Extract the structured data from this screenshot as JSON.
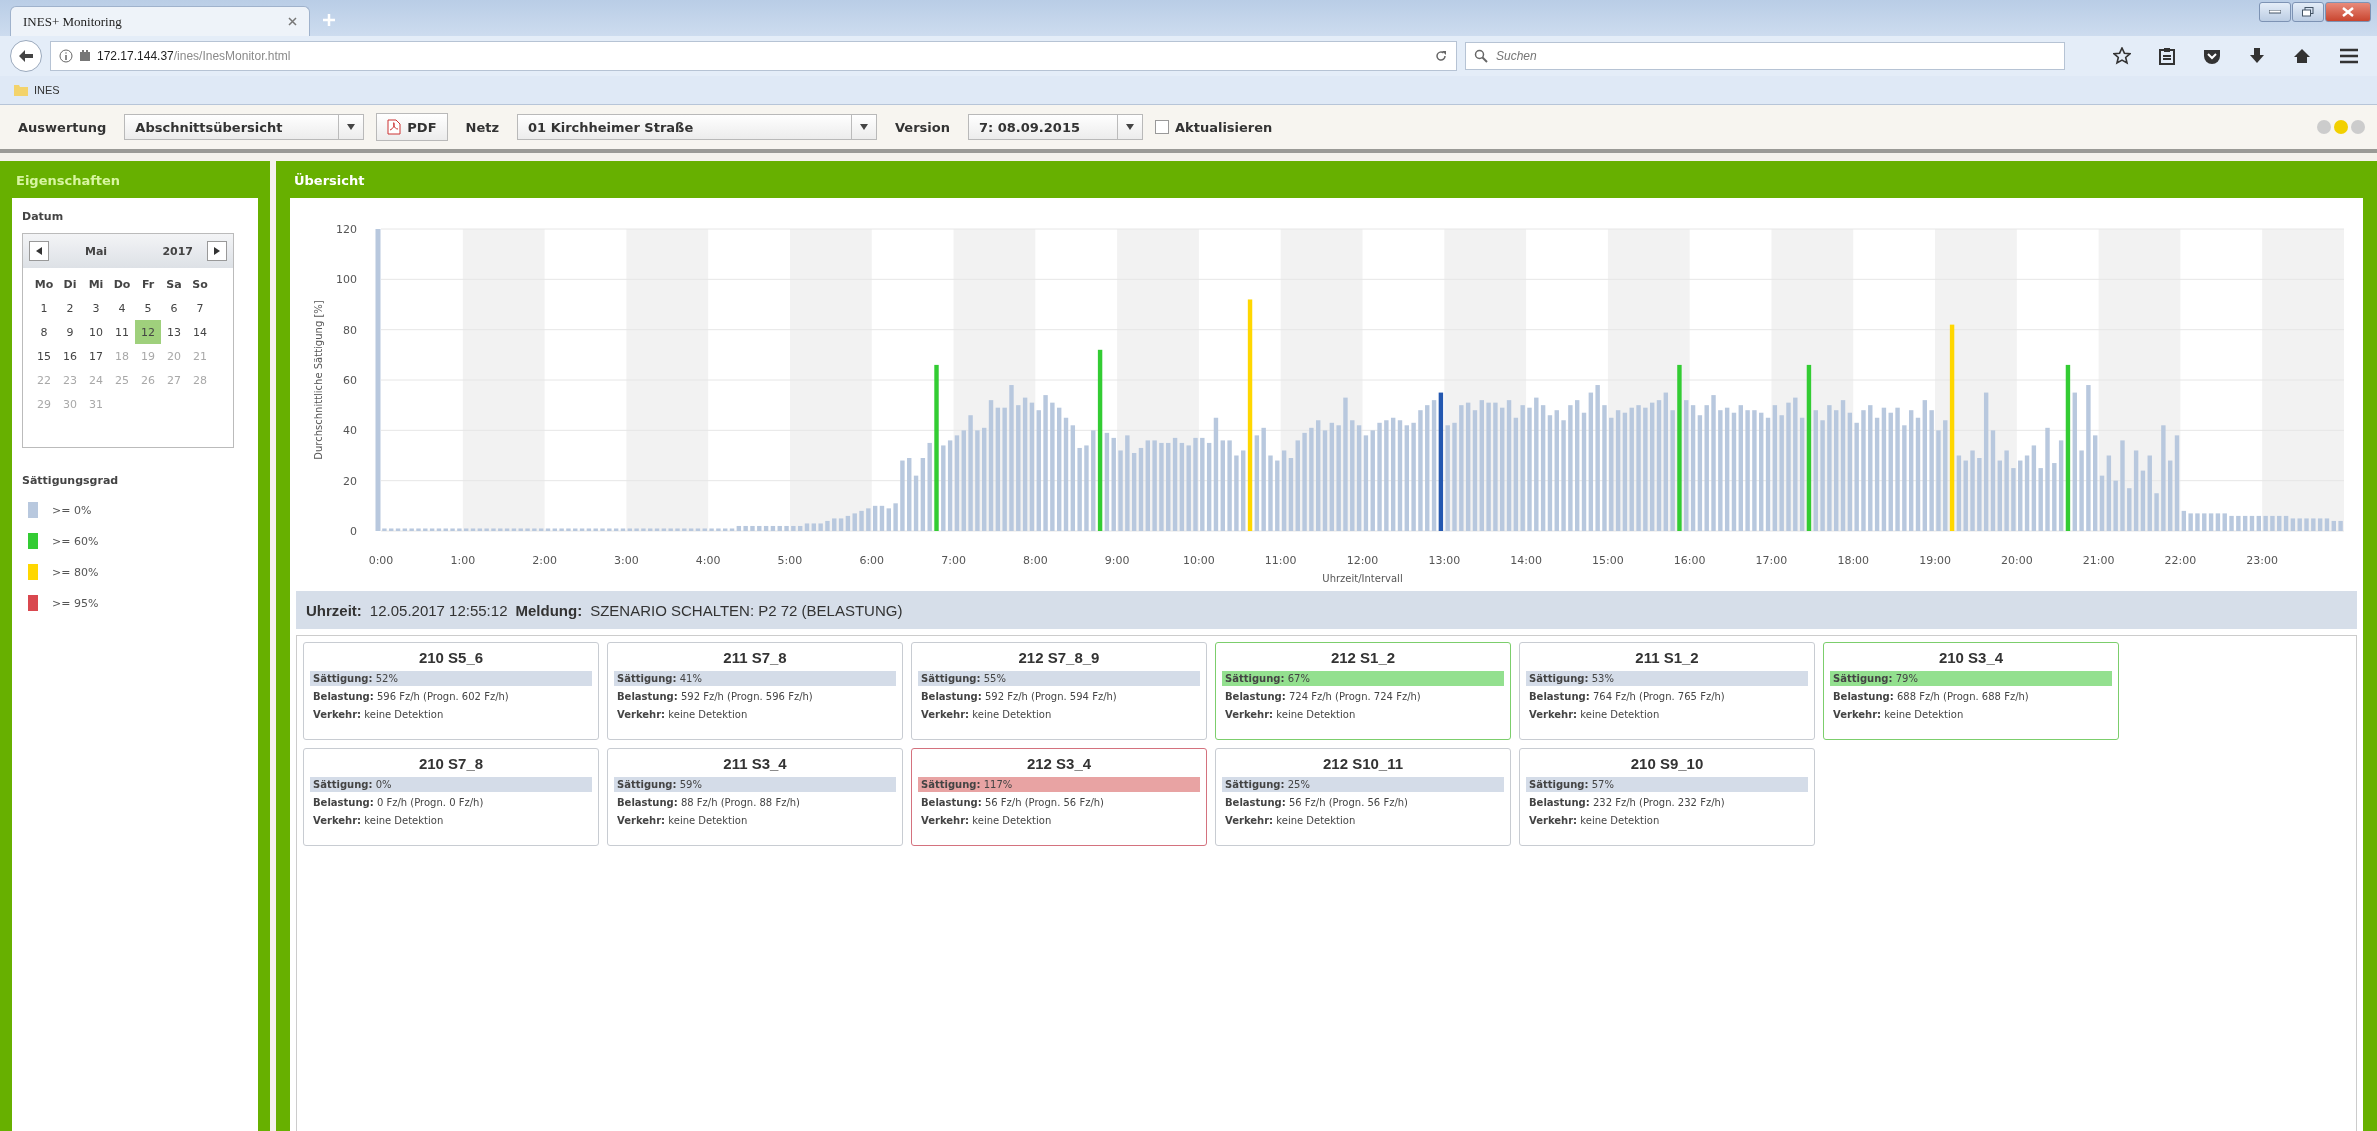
{
  "browser": {
    "tab_title": "INES+ Monitoring",
    "url_host": "172.17.144.37",
    "url_path": "/ines/InesMonitor.html",
    "search": {
      "placeholder": "Suchen"
    },
    "bookmarks": [
      "INES"
    ]
  },
  "toolbar": {
    "evaluation_label": "Auswertung",
    "evaluation_value": "Abschnittsübersicht",
    "pdf_button": "PDF",
    "network_label": "Netz",
    "network_value": "01 Kirchheimer Straße",
    "version_label": "Version",
    "version_value": "7: 08.09.2015",
    "refresh": {
      "label": "Aktualisieren",
      "checked": false
    },
    "status_lights": [
      {
        "color": "#cccccc"
      },
      {
        "color": "#f2d000"
      },
      {
        "color": "#cccccc"
      }
    ]
  },
  "sidebar": {
    "title": "Eigenschaften",
    "date_label": "Datum",
    "calendar": {
      "month": "Mai",
      "year": "2017",
      "weekdays": [
        "Mo",
        "Di",
        "Mi",
        "Do",
        "Fr",
        "Sa",
        "So"
      ],
      "days": [
        {
          "label": "1",
          "selected": false,
          "disabled": false
        },
        {
          "label": "2",
          "selected": false,
          "disabled": false
        },
        {
          "label": "3",
          "selected": false,
          "disabled": false
        },
        {
          "label": "4",
          "selected": false,
          "disabled": false
        },
        {
          "label": "5",
          "selected": false,
          "disabled": false
        },
        {
          "label": "6",
          "selected": false,
          "disabled": false
        },
        {
          "label": "7",
          "selected": false,
          "disabled": false
        },
        {
          "label": "8",
          "selected": false,
          "disabled": false
        },
        {
          "label": "9",
          "selected": false,
          "disabled": false
        },
        {
          "label": "10",
          "selected": false,
          "disabled": false
        },
        {
          "label": "11",
          "selected": false,
          "disabled": false
        },
        {
          "label": "12",
          "selected": true,
          "disabled": false
        },
        {
          "label": "13",
          "selected": false,
          "disabled": false
        },
        {
          "label": "14",
          "selected": false,
          "disabled": false
        },
        {
          "label": "15",
          "selected": false,
          "disabled": false
        },
        {
          "label": "16",
          "selected": false,
          "disabled": false
        },
        {
          "label": "17",
          "selected": false,
          "disabled": false
        },
        {
          "label": "18",
          "selected": false,
          "disabled": true
        },
        {
          "label": "19",
          "selected": false,
          "disabled": true
        },
        {
          "label": "20",
          "selected": false,
          "disabled": true
        },
        {
          "label": "21",
          "selected": false,
          "disabled": true
        },
        {
          "label": "22",
          "selected": false,
          "disabled": true
        },
        {
          "label": "23",
          "selected": false,
          "disabled": true
        },
        {
          "label": "24",
          "selected": false,
          "disabled": true
        },
        {
          "label": "25",
          "selected": false,
          "disabled": true
        },
        {
          "label": "26",
          "selected": false,
          "disabled": true
        },
        {
          "label": "27",
          "selected": false,
          "disabled": true
        },
        {
          "label": "28",
          "selected": false,
          "disabled": true
        },
        {
          "label": "29",
          "selected": false,
          "disabled": true
        },
        {
          "label": "30",
          "selected": false,
          "disabled": true
        },
        {
          "label": "31",
          "selected": false,
          "disabled": true
        }
      ]
    },
    "legend_title": "Sättigungsgrad",
    "legend": [
      {
        "label": ">= 0%",
        "color": "#b8c8de"
      },
      {
        "label": ">= 60%",
        "color": "#33cc33"
      },
      {
        "label": ">= 80%",
        "color": "#ffd700"
      },
      {
        "label": ">= 95%",
        "color": "#d9484f"
      }
    ]
  },
  "main": {
    "title": "Übersicht",
    "chart_data": {
      "type": "bar",
      "xlabel": "Uhrzeit/Intervall",
      "ylabel": "Durchschnittliche Sättigung [%]",
      "ylim": [
        0,
        120
      ],
      "grid": true,
      "xlim": [
        0,
        1440
      ],
      "x": [
        0,
        5,
        10,
        15,
        20,
        25,
        30,
        35,
        40,
        45,
        50,
        55,
        60,
        65,
        70,
        75,
        80,
        85,
        90,
        95,
        100,
        105,
        110,
        115,
        120,
        125,
        130,
        135,
        140,
        145,
        150,
        155,
        160,
        165,
        170,
        175,
        180,
        185,
        190,
        195,
        200,
        205,
        210,
        215,
        220,
        225,
        230,
        235,
        240,
        245,
        250,
        255,
        260,
        265,
        270,
        275,
        280,
        285,
        290,
        295,
        300,
        305,
        310,
        315,
        320,
        325,
        330,
        335,
        340,
        345,
        350,
        355,
        360,
        365,
        370,
        375,
        380,
        385,
        390,
        395,
        400,
        405,
        410,
        415,
        420,
        425,
        430,
        435,
        440,
        445,
        450,
        455,
        460,
        465,
        470,
        475,
        480,
        485,
        490,
        495,
        500,
        505,
        510,
        515,
        520,
        525,
        530,
        535,
        540,
        545,
        550,
        555,
        560,
        565,
        570,
        575,
        580,
        585,
        590,
        595,
        600,
        605,
        610,
        615,
        620,
        625,
        630,
        635,
        640,
        645,
        650,
        655,
        660,
        665,
        670,
        675,
        680,
        685,
        690,
        695,
        700,
        705,
        710,
        715,
        720,
        725,
        730,
        735,
        740,
        745,
        750,
        755,
        760,
        765,
        770,
        775,
        780,
        785,
        790,
        795,
        800,
        805,
        810,
        815,
        820,
        825,
        830,
        835,
        840,
        845,
        850,
        855,
        860,
        865,
        870,
        875,
        880,
        885,
        890,
        895,
        900,
        905,
        910,
        915,
        920,
        925,
        930,
        935,
        940,
        945,
        950,
        955,
        960,
        965,
        970,
        975,
        980,
        985,
        990,
        995,
        1000,
        1005,
        1010,
        1015,
        1020,
        1025,
        1030,
        1035,
        1040,
        1045,
        1050,
        1055,
        1060,
        1065,
        1070,
        1075,
        1080,
        1085,
        1090,
        1095,
        1100,
        1105,
        1110,
        1115,
        1120,
        1125,
        1130,
        1135,
        1140,
        1145,
        1150,
        1155,
        1160,
        1165,
        1170,
        1175,
        1180,
        1185,
        1190,
        1195,
        1200,
        1205,
        1210,
        1215,
        1220,
        1225,
        1230,
        1235,
        1240,
        1245,
        1250,
        1255,
        1260,
        1265,
        1270,
        1275,
        1280,
        1285,
        1290,
        1295,
        1300,
        1305,
        1310,
        1315,
        1320,
        1325,
        1330,
        1335,
        1340,
        1345,
        1350,
        1355,
        1360,
        1365,
        1370,
        1375,
        1380,
        1385,
        1390,
        1395,
        1400,
        1405,
        1410,
        1415,
        1420,
        1425,
        1430,
        1435
      ],
      "yticks": [
        0,
        20,
        40,
        60,
        80,
        100,
        120
      ],
      "xticks": [
        {
          "value": 0,
          "label": "0:00"
        },
        {
          "value": 60,
          "label": "1:00"
        },
        {
          "value": 120,
          "label": "2:00"
        },
        {
          "value": 180,
          "label": "3:00"
        },
        {
          "value": 240,
          "label": "4:00"
        },
        {
          "value": 300,
          "label": "5:00"
        },
        {
          "value": 360,
          "label": "6:00"
        },
        {
          "value": 420,
          "label": "7:00"
        },
        {
          "value": 480,
          "label": "8:00"
        },
        {
          "value": 540,
          "label": "9:00"
        },
        {
          "value": 600,
          "label": "10:00"
        },
        {
          "value": 660,
          "label": "11:00"
        },
        {
          "value": 720,
          "label": "12:00"
        },
        {
          "value": 780,
          "label": "13:00"
        },
        {
          "value": 840,
          "label": "14:00"
        },
        {
          "value": 900,
          "label": "15:00"
        },
        {
          "value": 960,
          "label": "16:00"
        },
        {
          "value": 1020,
          "label": "17:00"
        },
        {
          "value": 1080,
          "label": "18:00"
        },
        {
          "value": 1140,
          "label": "19:00"
        },
        {
          "value": 1200,
          "label": "20:00"
        },
        {
          "value": 1260,
          "label": "21:00"
        },
        {
          "value": 1320,
          "label": "22:00"
        },
        {
          "value": 1380,
          "label": "23:00"
        }
      ],
      "series": [
        {
          "color": "#b8c8de",
          "values": [
            1,
            1,
            1,
            1,
            1,
            1,
            1,
            1,
            1,
            1,
            1,
            1,
            1,
            1,
            1,
            1,
            1,
            1,
            1,
            1,
            1,
            1,
            1,
            1,
            1,
            1,
            1,
            1,
            1,
            1,
            1,
            1,
            1,
            1,
            1,
            1,
            1,
            1,
            1,
            1,
            1,
            1,
            1,
            1,
            1,
            1,
            1,
            1,
            1,
            1,
            1,
            1,
            2,
            2,
            2,
            2,
            2,
            2,
            2,
            2,
            2,
            2,
            3,
            3,
            3,
            4,
            5,
            5,
            6,
            7,
            8,
            9,
            10,
            10,
            9,
            11,
            28,
            29,
            22,
            29,
            35,
            null,
            34,
            36,
            38,
            40,
            46,
            40,
            41,
            52,
            49,
            49,
            58,
            50,
            53,
            51,
            48,
            54,
            51,
            49,
            45,
            42,
            33,
            34,
            40,
            null,
            39,
            37,
            32,
            38,
            31,
            33,
            36,
            36,
            35,
            35,
            37,
            35,
            34,
            37,
            37,
            35,
            45,
            36,
            36,
            30,
            32,
            null,
            38,
            41,
            30,
            28,
            32,
            29,
            36,
            39,
            41,
            44,
            40,
            43,
            42,
            53,
            44,
            42,
            38,
            40,
            43,
            44,
            45,
            44,
            42,
            43,
            48,
            50,
            52,
            null,
            42,
            43,
            50,
            51,
            48,
            52,
            51,
            51,
            49,
            52,
            45,
            50,
            49,
            53,
            50,
            46,
            48,
            44,
            50,
            52,
            47,
            55,
            58,
            50,
            45,
            48,
            47,
            49,
            50,
            49,
            51,
            52,
            55,
            48,
            null,
            52,
            50,
            46,
            50,
            54,
            48,
            49,
            47,
            50,
            48,
            48,
            47,
            45,
            50,
            46,
            51,
            53,
            45,
            null,
            48,
            44,
            50,
            48,
            52,
            47,
            43,
            48,
            50,
            45,
            49,
            47,
            49,
            42,
            48,
            45,
            52,
            48,
            40,
            44,
            null,
            30,
            28,
            32,
            29,
            55,
            40,
            28,
            32,
            25,
            28,
            30,
            34,
            25,
            41,
            27,
            36,
            null,
            55,
            32,
            58,
            38,
            22,
            30,
            20,
            36,
            17,
            32,
            24,
            30,
            15,
            42,
            28,
            38,
            8,
            7,
            7,
            7,
            7,
            7,
            7,
            6,
            6,
            6,
            6,
            6,
            6,
            6,
            6,
            6,
            5,
            5,
            5,
            5,
            5,
            5,
            4,
            4
          ]
        },
        {
          "color": "#33cc33",
          "values": [
            null,
            null,
            null,
            null,
            null,
            null,
            null,
            null,
            null,
            null,
            null,
            null,
            null,
            null,
            null,
            null,
            null,
            null,
            null,
            null,
            null,
            null,
            null,
            null,
            null,
            null,
            null,
            null,
            null,
            null,
            null,
            null,
            null,
            null,
            null,
            null,
            null,
            null,
            null,
            null,
            null,
            null,
            null,
            null,
            null,
            null,
            null,
            null,
            null,
            null,
            null,
            null,
            null,
            null,
            null,
            null,
            null,
            null,
            null,
            null,
            null,
            null,
            null,
            null,
            null,
            null,
            null,
            null,
            null,
            null,
            null,
            null,
            null,
            null,
            null,
            null,
            null,
            null,
            null,
            null,
            null,
            66,
            null,
            null,
            null,
            null,
            null,
            null,
            null,
            null,
            null,
            null,
            null,
            null,
            null,
            null,
            null,
            null,
            null,
            null,
            null,
            null,
            null,
            null,
            null,
            72,
            null,
            null,
            null,
            null,
            null,
            null,
            null,
            null,
            null,
            null,
            null,
            null,
            null,
            null,
            null,
            null,
            null,
            null,
            null,
            null,
            null,
            null,
            null,
            null,
            null,
            null,
            null,
            null,
            null,
            null,
            null,
            null,
            null,
            null,
            null,
            null,
            null,
            null,
            null,
            null,
            null,
            null,
            null,
            null,
            null,
            null,
            null,
            null,
            null,
            null,
            null,
            null,
            null,
            null,
            null,
            null,
            null,
            null,
            null,
            null,
            null,
            null,
            null,
            null,
            null,
            null,
            null,
            null,
            null,
            null,
            null,
            null,
            null,
            null,
            null,
            null,
            null,
            null,
            null,
            null,
            null,
            null,
            null,
            null,
            66,
            null,
            null,
            null,
            null,
            null,
            null,
            null,
            null,
            null,
            null,
            null,
            null,
            null,
            null,
            null,
            null,
            null,
            null,
            66,
            null,
            null,
            null,
            null,
            null,
            null,
            null,
            null,
            null,
            null,
            null,
            null,
            null,
            null,
            null,
            null,
            null,
            null,
            null,
            null,
            null,
            null,
            null,
            null,
            null,
            null,
            null,
            null,
            null,
            null,
            null,
            null,
            null,
            null,
            null,
            null,
            null,
            66,
            null,
            null,
            null,
            null,
            null,
            null,
            null,
            null,
            null,
            null,
            null,
            null,
            null,
            null,
            null,
            null,
            null,
            null,
            null,
            null,
            null,
            null,
            null,
            null,
            null,
            null,
            null,
            null,
            null,
            null,
            null,
            null,
            null,
            null,
            null,
            null,
            null,
            null,
            null,
            null
          ]
        },
        {
          "color": "#ffd700",
          "values": [
            null,
            null,
            null,
            null,
            null,
            null,
            null,
            null,
            null,
            null,
            null,
            null,
            null,
            null,
            null,
            null,
            null,
            null,
            null,
            null,
            null,
            null,
            null,
            null,
            null,
            null,
            null,
            null,
            null,
            null,
            null,
            null,
            null,
            null,
            null,
            null,
            null,
            null,
            null,
            null,
            null,
            null,
            null,
            null,
            null,
            null,
            null,
            null,
            null,
            null,
            null,
            null,
            null,
            null,
            null,
            null,
            null,
            null,
            null,
            null,
            null,
            null,
            null,
            null,
            null,
            null,
            null,
            null,
            null,
            null,
            null,
            null,
            null,
            null,
            null,
            null,
            null,
            null,
            null,
            null,
            null,
            null,
            null,
            null,
            null,
            null,
            null,
            null,
            null,
            null,
            null,
            null,
            null,
            null,
            null,
            null,
            null,
            null,
            null,
            null,
            null,
            null,
            null,
            null,
            null,
            null,
            null,
            null,
            null,
            null,
            null,
            null,
            null,
            null,
            null,
            null,
            null,
            null,
            null,
            null,
            null,
            null,
            null,
            null,
            null,
            null,
            null,
            92,
            null,
            null,
            null,
            null,
            null,
            null,
            null,
            null,
            null,
            null,
            null,
            null,
            null,
            null,
            null,
            null,
            null,
            null,
            null,
            null,
            null,
            null,
            null,
            null,
            null,
            null,
            null,
            null,
            null,
            null,
            null,
            null,
            null,
            null,
            null,
            null,
            null,
            null,
            null,
            null,
            null,
            null,
            null,
            null,
            null,
            null,
            null,
            null,
            null,
            null,
            null,
            null,
            null,
            null,
            null,
            null,
            null,
            null,
            null,
            null,
            null,
            null,
            null,
            null,
            null,
            null,
            null,
            null,
            null,
            null,
            null,
            null,
            null,
            null,
            null,
            null,
            null,
            null,
            null,
            null,
            null,
            null,
            null,
            null,
            null,
            null,
            null,
            null,
            null,
            null,
            null,
            null,
            null,
            null,
            null,
            null,
            null,
            null,
            null,
            null,
            null,
            null,
            82,
            null,
            null,
            null,
            null,
            null,
            null,
            null,
            null,
            null,
            null,
            null,
            null,
            null,
            null,
            null,
            null,
            null,
            null,
            null,
            null,
            null,
            null,
            null,
            null,
            null,
            null,
            null,
            null,
            null,
            null,
            null,
            null,
            null,
            null,
            null,
            null,
            null,
            null,
            null,
            null,
            null,
            null,
            null,
            null,
            null,
            null,
            null,
            null,
            null,
            null,
            null,
            null,
            null,
            null,
            null,
            null,
            null
          ]
        },
        {
          "color": "#2458b0",
          "values": [
            null,
            null,
            null,
            null,
            null,
            null,
            null,
            null,
            null,
            null,
            null,
            null,
            null,
            null,
            null,
            null,
            null,
            null,
            null,
            null,
            null,
            null,
            null,
            null,
            null,
            null,
            null,
            null,
            null,
            null,
            null,
            null,
            null,
            null,
            null,
            null,
            null,
            null,
            null,
            null,
            null,
            null,
            null,
            null,
            null,
            null,
            null,
            null,
            null,
            null,
            null,
            null,
            null,
            null,
            null,
            null,
            null,
            null,
            null,
            null,
            null,
            null,
            null,
            null,
            null,
            null,
            null,
            null,
            null,
            null,
            null,
            null,
            null,
            null,
            null,
            null,
            null,
            null,
            null,
            null,
            null,
            null,
            null,
            null,
            null,
            null,
            null,
            null,
            null,
            null,
            null,
            null,
            null,
            null,
            null,
            null,
            null,
            null,
            null,
            null,
            null,
            null,
            null,
            null,
            null,
            null,
            null,
            null,
            null,
            null,
            null,
            null,
            null,
            null,
            null,
            null,
            null,
            null,
            null,
            null,
            null,
            null,
            null,
            null,
            null,
            null,
            null,
            null,
            null,
            null,
            null,
            null,
            null,
            null,
            null,
            null,
            null,
            null,
            null,
            null,
            null,
            null,
            null,
            null,
            null,
            null,
            null,
            null,
            null,
            null,
            null,
            null,
            null,
            null,
            null,
            55,
            null,
            null,
            null,
            null,
            null,
            null,
            null,
            null,
            null,
            null,
            null,
            null,
            null,
            null,
            null,
            null,
            null,
            null,
            null,
            null,
            null,
            null,
            null,
            null,
            null,
            null,
            null,
            null,
            null,
            null,
            null,
            null,
            null,
            null,
            null,
            null,
            null,
            null,
            null,
            null,
            null,
            null,
            null,
            null,
            null,
            null,
            null,
            null,
            null,
            null,
            null,
            null,
            null,
            null,
            null,
            null,
            null,
            null,
            null,
            null,
            null,
            null,
            null,
            null,
            null,
            null,
            null,
            null,
            null,
            null,
            null,
            null,
            null,
            null,
            null,
            null,
            null,
            null,
            null,
            null,
            null,
            null,
            null,
            null,
            null,
            null,
            null,
            null,
            null,
            null,
            null,
            null,
            null,
            null,
            null,
            null,
            null,
            null,
            null,
            null,
            null,
            null,
            null,
            null,
            null,
            null,
            null,
            null,
            null,
            null,
            null,
            null,
            null,
            null,
            null,
            null,
            null,
            null,
            null,
            null,
            null,
            null,
            null,
            null,
            null,
            null,
            null,
            null,
            null,
            null,
            null,
            null
          ]
        }
      ]
    },
    "message": {
      "time_label": "Uhrzeit:",
      "time": "12.05.2017 12:55:12",
      "message_label": "Meldung:",
      "message": "SZENARIO SCHALTEN: P2 72 (BELASTUNG)"
    },
    "cards": [
      {
        "title": "210 S5_6",
        "kind": "normal",
        "saturation_label": "Sättigung:",
        "saturation": "52%",
        "load_label": "Belastung:",
        "load": "596 Fz/h (Progn. 602 Fz/h)",
        "traffic_label": "Verkehr:",
        "traffic": "keine Detektion"
      },
      {
        "title": "211 S7_8",
        "kind": "normal",
        "saturation_label": "Sättigung:",
        "saturation": "41%",
        "load_label": "Belastung:",
        "load": "592 Fz/h (Progn. 596 Fz/h)",
        "traffic_label": "Verkehr:",
        "traffic": "keine Detektion"
      },
      {
        "title": "212 S7_8_9",
        "kind": "normal",
        "saturation_label": "Sättigung:",
        "saturation": "55%",
        "load_label": "Belastung:",
        "load": "592 Fz/h (Progn. 594 Fz/h)",
        "traffic_label": "Verkehr:",
        "traffic": "keine Detektion"
      },
      {
        "title": "212 S1_2",
        "kind": "high",
        "saturation_label": "Sättigung:",
        "saturation": "67%",
        "load_label": "Belastung:",
        "load": "724 Fz/h (Progn. 724 Fz/h)",
        "traffic_label": "Verkehr:",
        "traffic": "keine Detektion"
      },
      {
        "title": "211 S1_2",
        "kind": "normal",
        "saturation_label": "Sättigung:",
        "saturation": "53%",
        "load_label": "Belastung:",
        "load": "764 Fz/h (Progn. 765 Fz/h)",
        "traffic_label": "Verkehr:",
        "traffic": "keine Detektion"
      },
      {
        "title": "210 S3_4",
        "kind": "high",
        "saturation_label": "Sättigung:",
        "saturation": "79%",
        "load_label": "Belastung:",
        "load": "688 Fz/h (Progn. 688 Fz/h)",
        "traffic_label": "Verkehr:",
        "traffic": "keine Detektion"
      },
      {
        "title": "210 S7_8",
        "kind": "normal",
        "saturation_label": "Sättigung:",
        "saturation": "0%",
        "load_label": "Belastung:",
        "load": "0 Fz/h (Progn. 0 Fz/h)",
        "traffic_label": "Verkehr:",
        "traffic": "keine Detektion"
      },
      {
        "title": "211 S3_4",
        "kind": "normal",
        "saturation_label": "Sättigung:",
        "saturation": "59%",
        "load_label": "Belastung:",
        "load": "88 Fz/h (Progn. 88 Fz/h)",
        "traffic_label": "Verkehr:",
        "traffic": "keine Detektion"
      },
      {
        "title": "212 S3_4",
        "kind": "overload",
        "saturation_label": "Sättigung:",
        "saturation": "117%",
        "load_label": "Belastung:",
        "load": "56 Fz/h (Progn. 56 Fz/h)",
        "traffic_label": "Verkehr:",
        "traffic": "keine Detektion"
      },
      {
        "title": "212 S10_11",
        "kind": "normal",
        "saturation_label": "Sättigung:",
        "saturation": "25%",
        "load_label": "Belastung:",
        "load": "56 Fz/h (Progn. 56 Fz/h)",
        "traffic_label": "Verkehr:",
        "traffic": "keine Detektion"
      },
      {
        "title": "210 S9_10",
        "kind": "normal",
        "saturation_label": "Sättigung:",
        "saturation": "57%",
        "load_label": "Belastung:",
        "load": "232 Fz/h (Progn. 232 Fz/h)",
        "traffic_label": "Verkehr:",
        "traffic": "keine Detektion"
      }
    ]
  }
}
